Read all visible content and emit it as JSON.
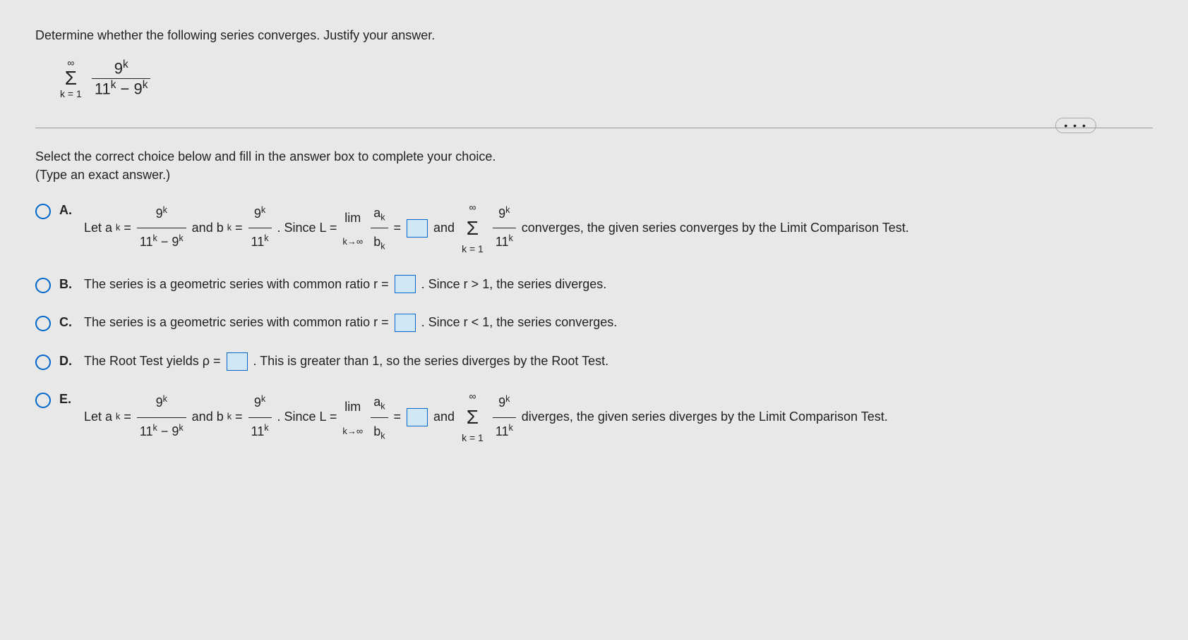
{
  "question": "Determine whether the following series converges. Justify your answer.",
  "series": {
    "top": "∞",
    "bottom": "k = 1",
    "num": "9",
    "num_exp": "k",
    "den_a": "11",
    "den_a_exp": "k",
    "den_b": "9",
    "den_b_exp": "k"
  },
  "instruction": "Select the correct choice below and fill in the answer box to complete your choice.",
  "sub_instruction": "(Type an exact answer.)",
  "ellipsis": "• • •",
  "choices": {
    "A": {
      "label": "A.",
      "p1": "Let  a",
      "p1sub": "k",
      "p2": " = ",
      "p3": " and b",
      "p3sub": "k",
      "p4": " = ",
      "p5": ". Since L = ",
      "lim": "lim",
      "limsub": "k→∞",
      "p6": " = ",
      "p7": " and ",
      "p8": " converges, the given series converges by the Limit Comparison Test.",
      "frac_ak_num": "a",
      "frac_ak_num_sub": "k",
      "frac_bk_den": "b",
      "frac_bk_den_sub": "k"
    },
    "B": {
      "label": "B.",
      "p1": "The series is a geometric series with common ratio r = ",
      "p2": ". Since r > 1, the series diverges."
    },
    "C": {
      "label": "C.",
      "p1": "The series is a geometric series with common ratio r = ",
      "p2": ". Since r < 1, the series converges."
    },
    "D": {
      "label": "D.",
      "p1": "The Root Test yields ρ = ",
      "p2": ". This is greater than 1, so the series diverges by the Root Test."
    },
    "E": {
      "label": "E.",
      "p8": " diverges, the given series diverges by the Limit Comparison Test."
    }
  },
  "math": {
    "nine_k": "9",
    "nine_k_exp": "k",
    "eleven_k": "11",
    "eleven_k_exp": "k",
    "minus": " − ",
    "sigma_top": "∞",
    "sigma_bottom": "k = 1"
  }
}
